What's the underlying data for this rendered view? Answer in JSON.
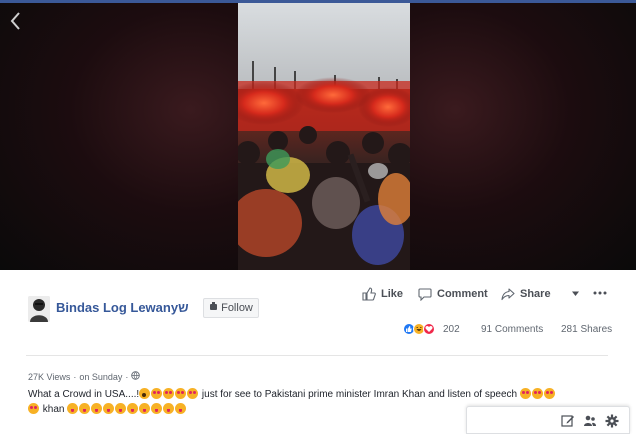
{
  "video": {
    "back_icon": "chevron-left-icon"
  },
  "post": {
    "author": "Bindas Log Lewanyש",
    "follow_label": "Follow",
    "actions": {
      "like": "Like",
      "comment": "Comment",
      "share": "Share"
    },
    "reaction_count": "202",
    "comments": "91 Comments",
    "shares": "281 Shares",
    "views": "27K Views",
    "separator": "·",
    "time": "on Sunday",
    "caption_part1": "What a Crowd in USA....!",
    "caption_part2": " just for see to Pakistani prime minister Imran Khan and listen of speech ",
    "caption_part3": " khan "
  },
  "colors": {
    "link_blue": "#365899",
    "facebook_blue": "#3b5998",
    "like_blue": "#2078f4",
    "love_red": "#f0284a",
    "haha_yellow": "#f7b125"
  },
  "chat_bar": {
    "icons": [
      "compose-icon",
      "people-icon",
      "settings-gear-icon"
    ]
  }
}
